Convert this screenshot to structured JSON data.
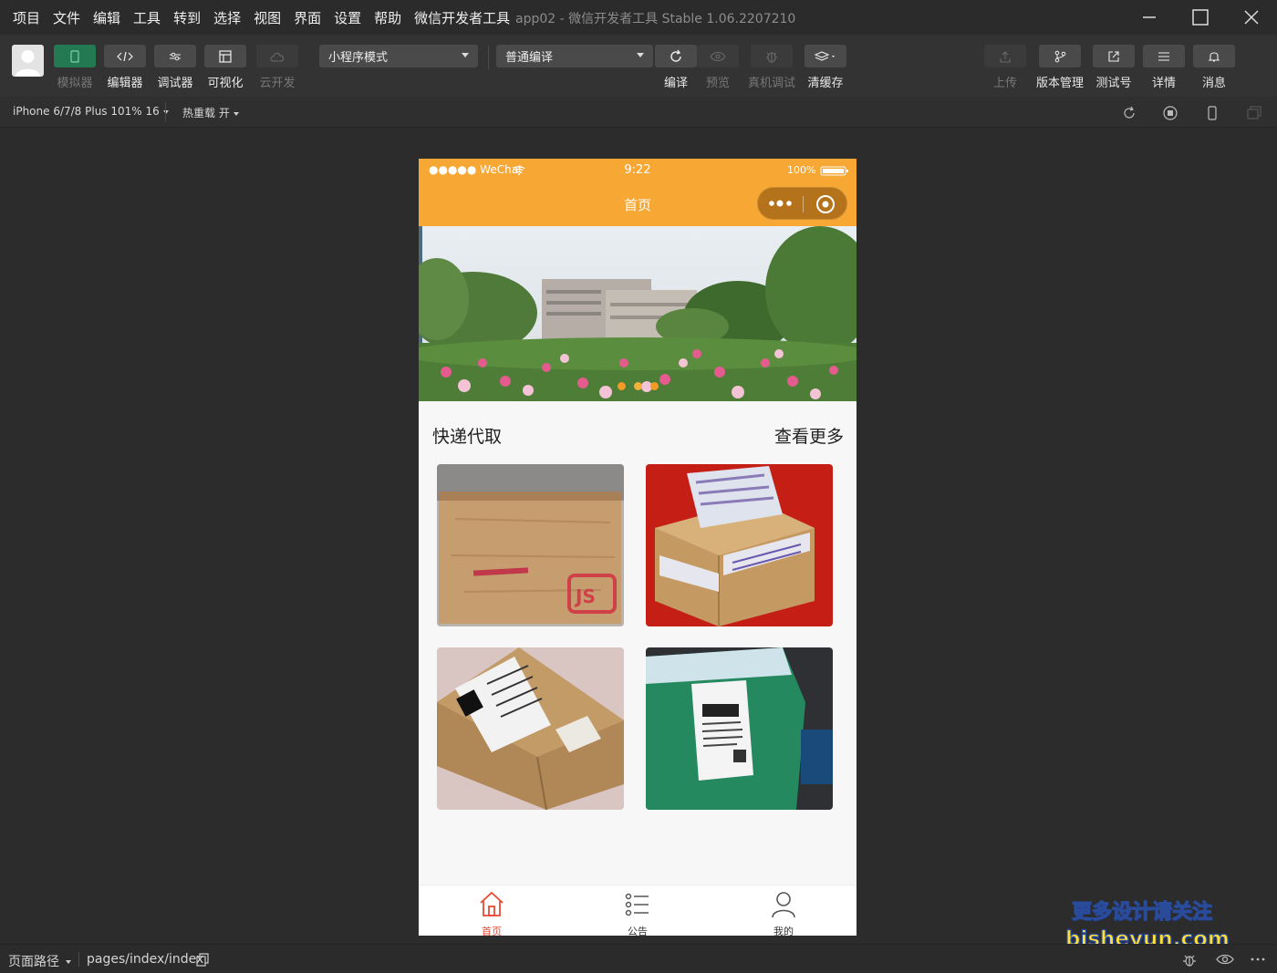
{
  "menu": [
    "项目",
    "文件",
    "编辑",
    "工具",
    "转到",
    "选择",
    "视图",
    "界面",
    "设置",
    "帮助",
    "微信开发者工具"
  ],
  "window_title": "app02 - 微信开发者工具 Stable 1.06.2207210",
  "toolbar": {
    "left_tools": [
      {
        "label": "模拟器",
        "icon": "phone-icon",
        "state": "active-dim-label"
      },
      {
        "label": "编辑器",
        "icon": "code-icon"
      },
      {
        "label": "调试器",
        "icon": "debug-switch-icon"
      },
      {
        "label": "可视化",
        "icon": "layout-icon"
      },
      {
        "label": "云开发",
        "icon": "cloud-icon",
        "state": "disabled"
      }
    ],
    "mode_select": "小程序模式",
    "compile_select": "普通编译",
    "center_tools": [
      {
        "label": "编译",
        "icon": "refresh-icon"
      },
      {
        "label": "预览",
        "icon": "eye-icon",
        "state": "disabled"
      },
      {
        "label": "真机调试",
        "icon": "bug-icon",
        "state": "disabled"
      },
      {
        "label": "清缓存",
        "icon": "layers-icon"
      }
    ],
    "right_tools": [
      {
        "label": "上传",
        "icon": "upload-icon",
        "state": "disabled"
      },
      {
        "label": "版本管理",
        "icon": "branch-icon"
      },
      {
        "label": "测试号",
        "icon": "external-link-icon"
      },
      {
        "label": "详情",
        "icon": "menu-lines-icon"
      },
      {
        "label": "消息",
        "icon": "bell-icon"
      }
    ]
  },
  "subbar": {
    "device": "iPhone 6/7/8 Plus 101% 16",
    "hot_reload": "热重载 开"
  },
  "phone": {
    "status": {
      "carrier": "●●●●● WeChat",
      "time": "9:22",
      "battery": "100%"
    },
    "nav_title": "首页",
    "section_title": "快递代取",
    "section_more": "查看更多",
    "tabs": [
      {
        "label": "首页",
        "icon": "home-icon",
        "active": true
      },
      {
        "label": "公告",
        "icon": "list-icon",
        "active": false
      },
      {
        "label": "我的",
        "icon": "user-icon",
        "active": false
      }
    ]
  },
  "bottombar": {
    "path_label": "页面路径",
    "path": "pages/index/index"
  },
  "watermark": {
    "line1": "更多设计请关注",
    "line2": "bisheyun.com"
  },
  "colors": {
    "accent": "#f7a733",
    "tab_active": "#e94b35",
    "simulator_active": "#237a52"
  }
}
